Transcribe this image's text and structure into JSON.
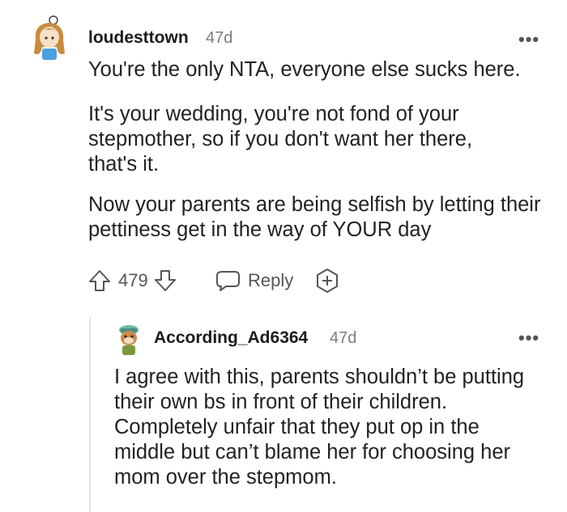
{
  "comment": {
    "username": "loudesttown",
    "age": "47d",
    "more_label": "•••",
    "paragraphs": [
      "You're the only NTA, everyone else sucks here.",
      "It's your wedding, you're not fond of your stepmother, so if you don't want her there, that's it.",
      "Now your parents are being selfish by letting their pettiness get in the way of YOUR day"
    ],
    "score": "479",
    "reply_label": "Reply"
  },
  "reply": {
    "username": "According_Ad6364",
    "age": "47d",
    "more_label": "•••",
    "text": "I agree with this, parents shouldn’t be putting their own bs in front of their children. Completely unfair that they put op in the middle but can’t blame her for choosing her mom over the stepmom."
  },
  "icons": {
    "upvote": "arrow-up-outline",
    "downvote": "arrow-down-outline",
    "reply": "speech-bubble",
    "award": "award-plus"
  }
}
